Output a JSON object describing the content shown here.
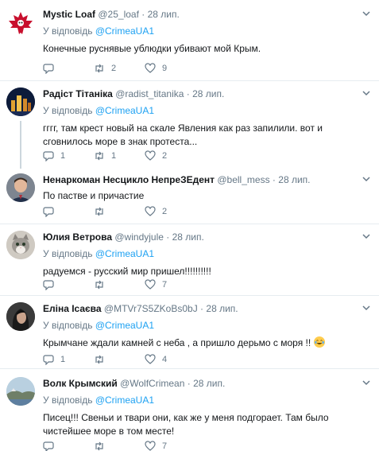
{
  "tweets": [
    {
      "name": "Mystic Loaf",
      "handle": "@25_loaf",
      "dot": "·",
      "date": "28 лип.",
      "reply_prefix": "У відповідь",
      "reply_link": "@CrimeaUA1",
      "text": "Конечные руснявые ублюдки убивают мой Крым.",
      "replies": "",
      "retweets": "2",
      "likes": "9",
      "avatar_icon": "maple-leaf-skull-avatar"
    },
    {
      "name": "Радіст Тітаніка",
      "handle": "@radist_titanika",
      "dot": "·",
      "date": "28 лип.",
      "reply_prefix": "У відповідь",
      "reply_link": "@CrimeaUA1",
      "text": "гггг, там крест новый на скале Явления как раз запилили. вот и сговнилось море в знак протеста...",
      "replies": "1",
      "retweets": "1",
      "likes": "2",
      "avatar_icon": "night-city-avatar"
    },
    {
      "name": "Ненаркоман Несцикло НепреЗЕдент",
      "handle": "@bell_mess",
      "dot": "·",
      "date": "28 лип.",
      "reply_prefix": "",
      "reply_link": "",
      "text": "По пастве и причастие",
      "replies": "",
      "retweets": "",
      "likes": "2",
      "avatar_icon": "man-portrait-avatar"
    },
    {
      "name": "Юлия Ветрова",
      "handle": "@windyjule",
      "dot": "·",
      "date": "28 лип.",
      "reply_prefix": "У відповідь",
      "reply_link": "@CrimeaUA1",
      "text": "радуемся - русский мир пришел!!!!!!!!!!",
      "replies": "",
      "retweets": "",
      "likes": "7",
      "avatar_icon": "kitten-avatar"
    },
    {
      "name": "Еліна Ісаєва",
      "handle": "@MTVr7S5ZKoBs0bJ",
      "dot": "·",
      "date": "28 лип.",
      "reply_prefix": "У відповідь",
      "reply_link": "@CrimeaUA1",
      "text": "Крымчане ждали камней с неба , а пришло дерьмо с моря !!",
      "replies": "1",
      "retweets": "",
      "likes": "4",
      "avatar_icon": "woman-portrait-avatar"
    },
    {
      "name": "Волк Крымский",
      "handle": "@WolfCrimean",
      "dot": "·",
      "date": "28 лип.",
      "reply_prefix": "У відповідь",
      "reply_link": "@CrimeaUA1",
      "text": "Писец!!! Свеньи и твари они, как же у меня подгорает. Там было чистейшее море в том месте!",
      "replies": "",
      "retweets": "",
      "likes": "7",
      "avatar_icon": "coastal-landscape-avatar"
    }
  ]
}
